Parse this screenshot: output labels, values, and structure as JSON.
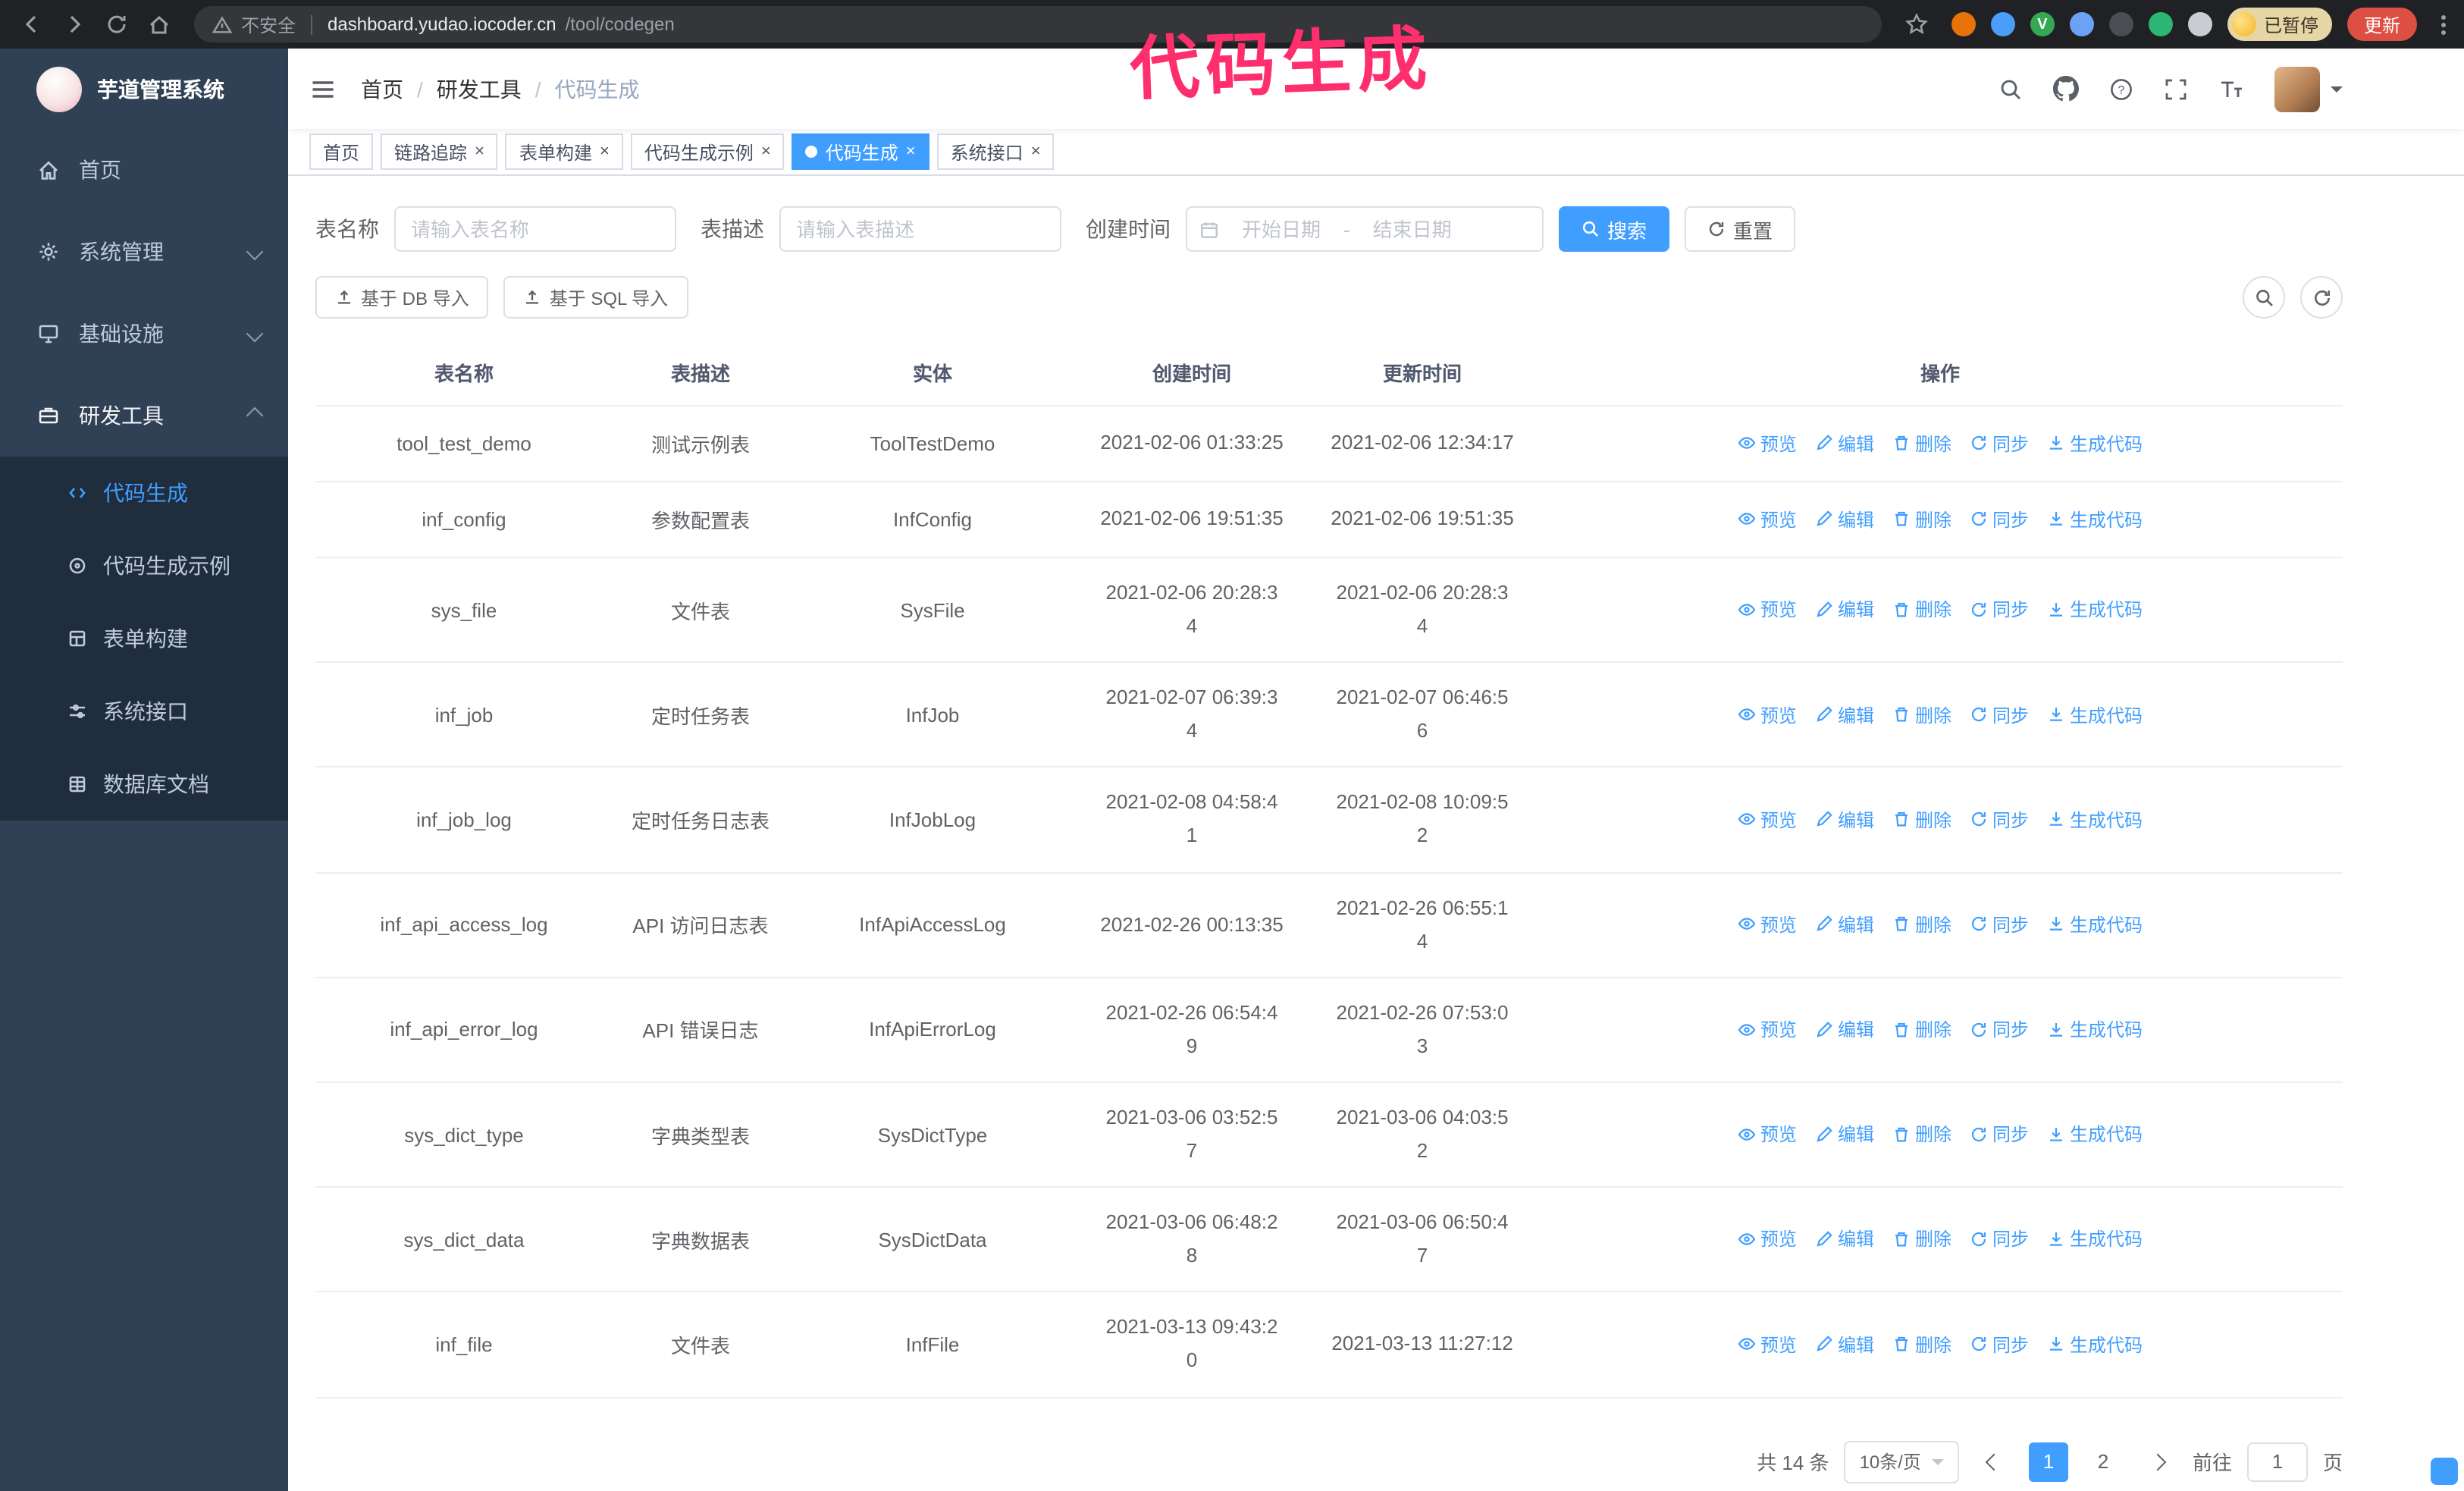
{
  "browser": {
    "security_label": "不安全",
    "url_host": "dashboard.yudao.iocoder.cn",
    "url_path": "/tool/codegen",
    "paused_badge": "已暂停",
    "update_button": "更新",
    "extensions": [
      {
        "name": "extension-icon-orange",
        "color": "#e8710a"
      },
      {
        "name": "extension-icon-blue",
        "color": "#4a9df8"
      },
      {
        "name": "extension-icon-green-v",
        "color": "#35a854",
        "glyph": "V"
      },
      {
        "name": "extension-icon-people",
        "color": "#6ba2f5"
      },
      {
        "name": "extension-icon-dark-green",
        "color": "#4a4d51"
      },
      {
        "name": "extension-icon-leaf",
        "color": "#2bb673"
      },
      {
        "name": "extension-icon-puzzle",
        "color": "#c9cdd1"
      }
    ]
  },
  "annotation": {
    "text": "代码生成",
    "color": "#ff2e6d"
  },
  "sidebar": {
    "logo_title": "芋道管理系统",
    "items": [
      {
        "label": "首页"
      },
      {
        "label": "系统管理"
      },
      {
        "label": "基础设施"
      },
      {
        "label": "研发工具"
      }
    ],
    "sub_items": [
      {
        "label": "代码生成",
        "active": true
      },
      {
        "label": "代码生成示例",
        "active": false
      },
      {
        "label": "表单构建",
        "active": false
      },
      {
        "label": "系统接口",
        "active": false
      },
      {
        "label": "数据库文档",
        "active": false
      }
    ]
  },
  "header": {
    "breadcrumb": {
      "items": [
        "首页",
        "研发工具",
        "代码生成"
      ],
      "separator": "/"
    }
  },
  "tabs": [
    {
      "label": "首页",
      "closable": false,
      "active": false
    },
    {
      "label": "链路追踪",
      "closable": true,
      "active": false
    },
    {
      "label": "表单构建",
      "closable": true,
      "active": false
    },
    {
      "label": "代码生成示例",
      "closable": true,
      "active": false
    },
    {
      "label": "代码生成",
      "closable": true,
      "active": true
    },
    {
      "label": "系统接口",
      "closable": true,
      "active": false
    }
  ],
  "ui": {
    "close_glyph": "×"
  },
  "filters": {
    "table_name_label": "表名称",
    "table_name_placeholder": "请输入表名称",
    "table_desc_label": "表描述",
    "table_desc_placeholder": "请输入表描述",
    "create_time_label": "创建时间",
    "date_start_placeholder": "开始日期",
    "date_separator": "-",
    "date_end_placeholder": "结束日期",
    "search_button": "搜索",
    "reset_button": "重置"
  },
  "toolbar": {
    "import_db_button": "基于 DB 导入",
    "import_sql_button": "基于 SQL 导入"
  },
  "table": {
    "columns": [
      "表名称",
      "表描述",
      "实体",
      "创建时间",
      "更新时间",
      "操作"
    ],
    "actions": [
      "预览",
      "编辑",
      "删除",
      "同步",
      "生成代码"
    ],
    "rows": [
      {
        "name": "tool_test_demo",
        "desc": "测试示例表",
        "entity": "ToolTestDemo",
        "create_time": "2021-02-06 01:33:25",
        "update_time": "2021-02-06 12:34:17"
      },
      {
        "name": "inf_config",
        "desc": "参数配置表",
        "entity": "InfConfig",
        "create_time": "2021-02-06 19:51:35",
        "update_time": "2021-02-06 19:51:35"
      },
      {
        "name": "sys_file",
        "desc": "文件表",
        "entity": "SysFile",
        "create_time": "2021-02-06 20:28:3\n4",
        "update_time": "2021-02-06 20:28:3\n4"
      },
      {
        "name": "inf_job",
        "desc": "定时任务表",
        "entity": "InfJob",
        "create_time": "2021-02-07 06:39:3\n4",
        "update_time": "2021-02-07 06:46:5\n6"
      },
      {
        "name": "inf_job_log",
        "desc": "定时任务日志表",
        "entity": "InfJobLog",
        "create_time": "2021-02-08 04:58:4\n1",
        "update_time": "2021-02-08 10:09:5\n2"
      },
      {
        "name": "inf_api_access_log",
        "desc": "API 访问日志表",
        "entity": "InfApiAccessLog",
        "create_time": "2021-02-26 00:13:35",
        "update_time": "2021-02-26 06:55:1\n4"
      },
      {
        "name": "inf_api_error_log",
        "desc": "API 错误日志",
        "entity": "InfApiErrorLog",
        "create_time": "2021-02-26 06:54:4\n9",
        "update_time": "2021-02-26 07:53:0\n3"
      },
      {
        "name": "sys_dict_type",
        "desc": "字典类型表",
        "entity": "SysDictType",
        "create_time": "2021-03-06 03:52:5\n7",
        "update_time": "2021-03-06 04:03:5\n2"
      },
      {
        "name": "sys_dict_data",
        "desc": "字典数据表",
        "entity": "SysDictData",
        "create_time": "2021-03-06 06:48:2\n8",
        "update_time": "2021-03-06 06:50:4\n7"
      },
      {
        "name": "inf_file",
        "desc": "文件表",
        "entity": "InfFile",
        "create_time": "2021-03-13 09:43:2\n0",
        "update_time": "2021-03-13 11:27:12"
      }
    ]
  },
  "pagination": {
    "total": "共 14 条",
    "page_size": "10条/页",
    "pages": [
      "1",
      "2"
    ],
    "current": "1",
    "goto_prefix": "前往",
    "goto_value": "1",
    "goto_suffix": "页"
  },
  "colors": {
    "accent": "#409eff",
    "sidebar_bg": "#304156",
    "submenu_bg": "#1f2d3d",
    "annotation_pink": "#ff2e6d",
    "update_button_red": "#dd4f43",
    "chrome_bg": "#202124"
  }
}
